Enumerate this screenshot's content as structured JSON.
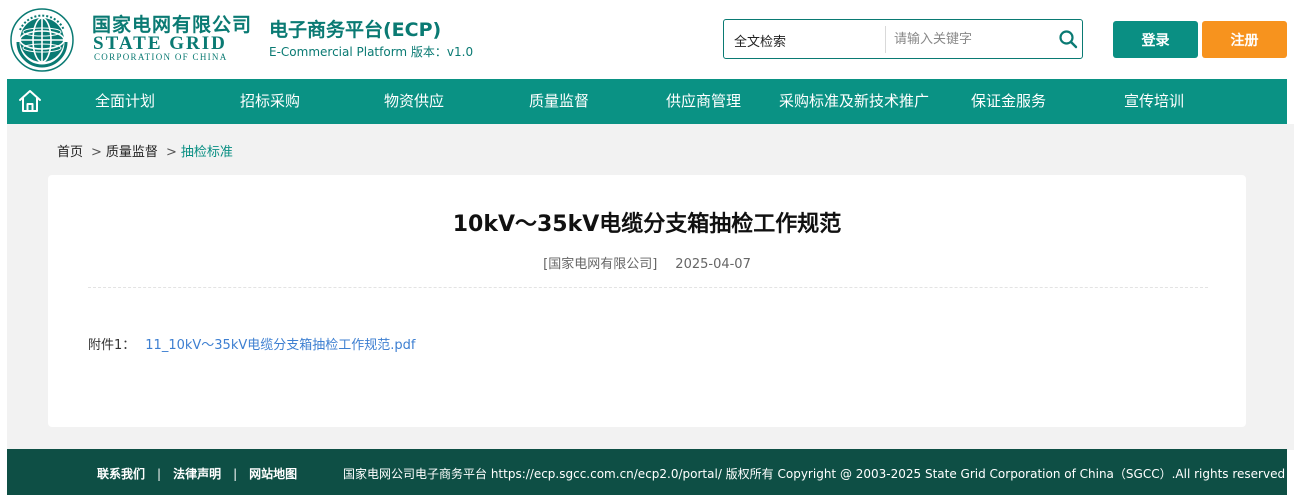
{
  "header": {
    "logo_cn": "国家电网有限公司",
    "logo_en": "STATE GRID",
    "logo_en_sub": "CORPORATION OF CHINA",
    "emblem_text": "国家电网公司 STATE GRID CORPORATION OF CHINA",
    "platform_title": "电子商务平台(ECP)",
    "platform_sub": "E-Commercial Platform 版本：v1.0"
  },
  "search": {
    "scope": "全文检索",
    "placeholder": "请输入关键字",
    "icon": "search-icon"
  },
  "auth": {
    "login_label": "登录",
    "register_label": "注册"
  },
  "nav": {
    "home_icon": "home-icon",
    "items": [
      {
        "label": "全面计划"
      },
      {
        "label": "招标采购"
      },
      {
        "label": "物资供应"
      },
      {
        "label": "质量监督"
      },
      {
        "label": "供应商管理"
      },
      {
        "label": "采购标准及新技术推广"
      },
      {
        "label": "保证金服务"
      },
      {
        "label": "宣传培训"
      }
    ]
  },
  "breadcrumb": {
    "home": "首页",
    "level1": "质量监督",
    "current": "抽检标准",
    "separator": ">"
  },
  "article": {
    "title": "10kV～35kV电缆分支箱抽检工作规范",
    "source": "[国家电网有限公司]",
    "date": "2025-04-07",
    "attachment_label": "附件1：",
    "attachment_name": "11_10kV～35kV电缆分支箱抽检工作规范.pdf"
  },
  "footer": {
    "links": [
      {
        "label": "联系我们"
      },
      {
        "label": "法律声明"
      },
      {
        "label": "网站地图"
      }
    ],
    "separator": "|",
    "copyright": "国家电网公司电子商务平台 https://ecp.sgcc.com.cn/ecp2.0/portal/ 版权所有 Copyright @ 2003-2025 State Grid Corporation of China（SGCC）.All rights reserved"
  },
  "colors": {
    "brand": "#0a7a73",
    "nav_bg": "#0a9284",
    "login_bg": "#0a8f83",
    "register_bg": "#f7931e",
    "footer_bg": "#0e4f45",
    "link": "#3d7fd1"
  }
}
